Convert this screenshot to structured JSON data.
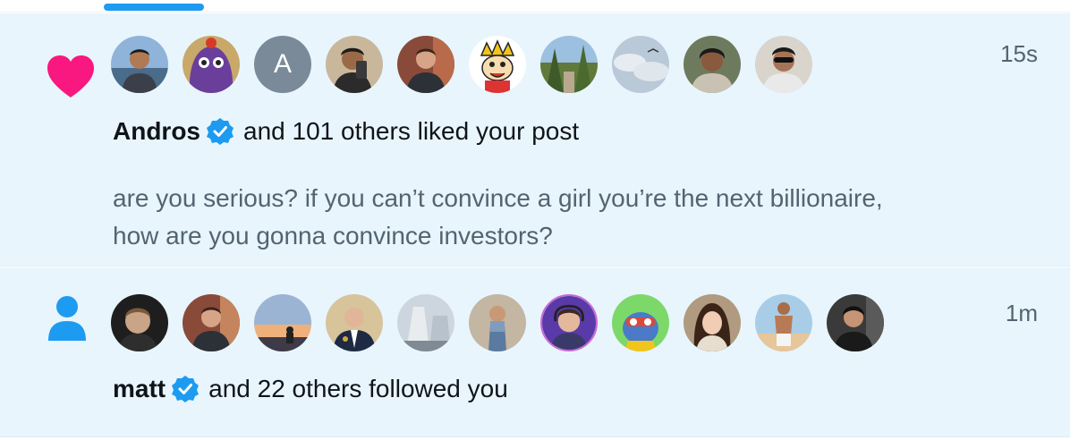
{
  "notifications": [
    {
      "type": "like",
      "icon": "heart-icon",
      "icon_color": "#f91880",
      "timestamp": "15s",
      "actor_name": "Andros",
      "action_text": "and 101 others liked your post",
      "post_text_line1": "are you serious? if you can’t convince a girl you’re the next billionaire,",
      "post_text_line2": "how are you gonna convince investors?",
      "avatars": [
        {
          "kind": "photo",
          "label": ""
        },
        {
          "kind": "photo",
          "label": ""
        },
        {
          "kind": "letter",
          "label": "A"
        },
        {
          "kind": "photo",
          "label": ""
        },
        {
          "kind": "photo",
          "label": ""
        },
        {
          "kind": "cartoon",
          "label": ""
        },
        {
          "kind": "photo",
          "label": ""
        },
        {
          "kind": "photo",
          "label": ""
        },
        {
          "kind": "photo",
          "label": ""
        },
        {
          "kind": "photo",
          "label": ""
        }
      ]
    },
    {
      "type": "follow",
      "icon": "person-icon",
      "icon_color": "#1d9bf0",
      "timestamp": "1m",
      "actor_name": "matt",
      "action_text": "and 22 others followed you",
      "avatars": [
        {
          "kind": "photo",
          "label": ""
        },
        {
          "kind": "photo",
          "label": ""
        },
        {
          "kind": "photo",
          "label": ""
        },
        {
          "kind": "photo",
          "label": ""
        },
        {
          "kind": "photo",
          "label": ""
        },
        {
          "kind": "photo",
          "label": ""
        },
        {
          "kind": "cartoon",
          "label": ""
        },
        {
          "kind": "photo",
          "label": ""
        },
        {
          "kind": "photo",
          "label": ""
        },
        {
          "kind": "photo",
          "label": ""
        }
      ]
    }
  ],
  "colors": {
    "accent": "#1d9bf0",
    "like": "#f91880",
    "unread_background": "#e8f5fd",
    "secondary_text": "#536471",
    "primary_text": "#0f1419"
  }
}
